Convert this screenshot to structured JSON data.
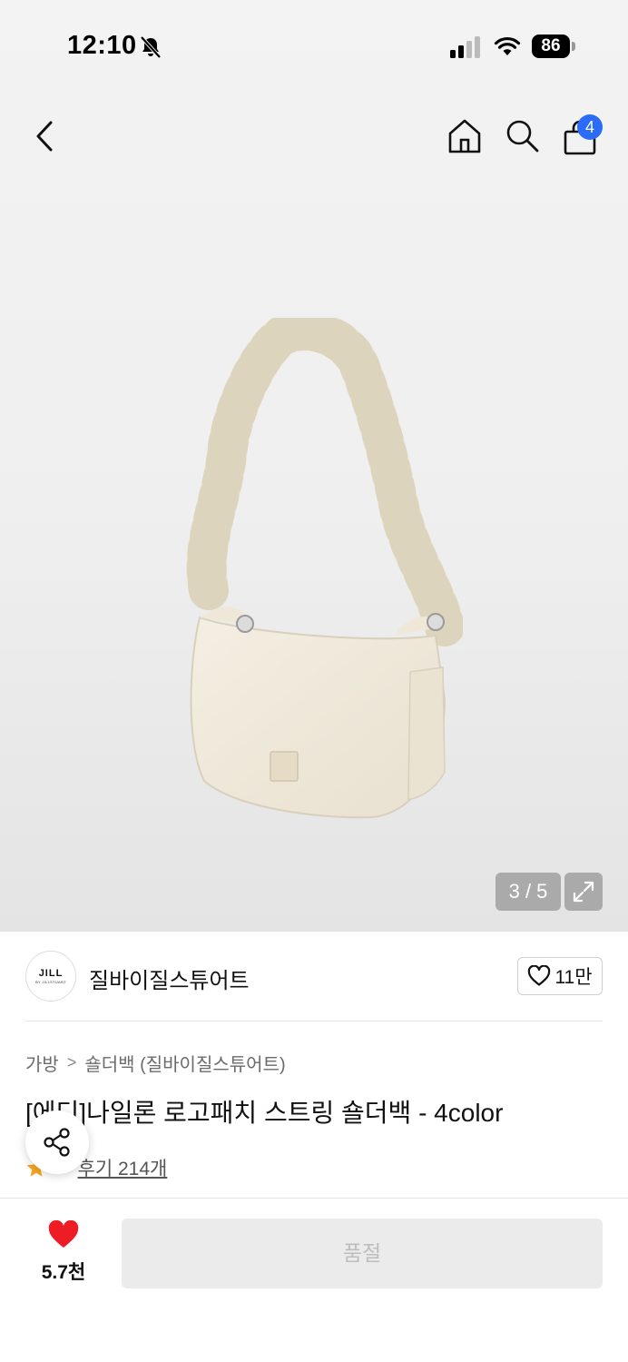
{
  "status_bar": {
    "time": "12:10",
    "battery": "86",
    "icons": [
      "bell-slash-icon",
      "cellular-signal-icon",
      "wifi-icon",
      "battery-icon"
    ]
  },
  "nav": {
    "icons": [
      "back-chevron-icon",
      "home-icon",
      "search-icon",
      "shopping-bag-icon"
    ],
    "cart_count": "4",
    "badge_color": "#2a6cf5"
  },
  "gallery": {
    "pager": "3 / 5",
    "expand_icon": "expand-arrows-icon"
  },
  "brand": {
    "logo_text": "JILL",
    "logo_subtext": "BY JILLSTUART",
    "name": "질바이질스튜어트",
    "like_count": "11만"
  },
  "breadcrumb": {
    "items": [
      "가방",
      "숄더백 (질바이질스튜어트)"
    ],
    "separator": ">"
  },
  "product": {
    "title": "[에디]나일론 로고패치 스트링 숄더백 - 4color",
    "rating_visible": ".8",
    "reviews": "후기 214개",
    "star_color": "#f5a623"
  },
  "bottom_bar": {
    "wish_count": "5.7천",
    "heart_color": "#ee1c25",
    "action_label": "품절"
  }
}
